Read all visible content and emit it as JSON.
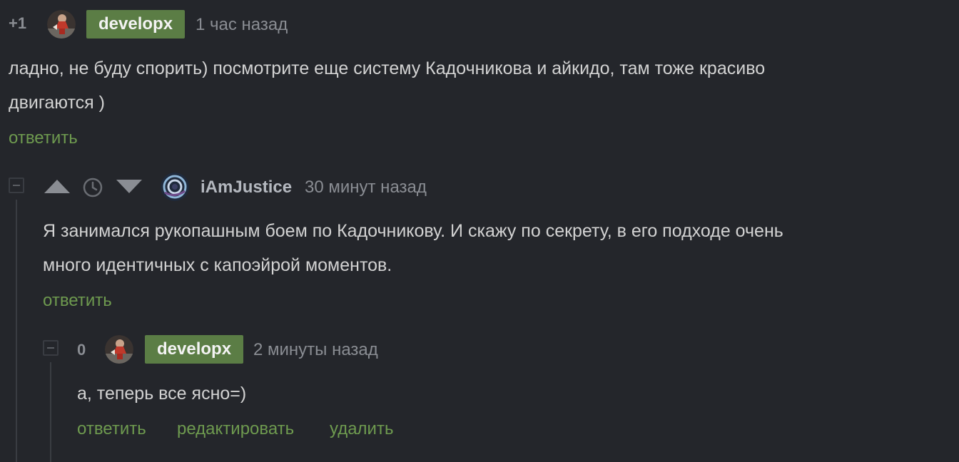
{
  "comments": [
    {
      "score": "+1",
      "author": "developx",
      "time": "1 час назад",
      "text_lines": [
        "ладно, не буду спорить) посмотрите еще систему Кадочникова и айкидо, там тоже красиво",
        "двигаются )"
      ],
      "actions": {
        "reply": "ответить"
      }
    },
    {
      "author": "iAmJustice",
      "time": "30 минут назад",
      "text_lines": [
        "Я занимался рукопашным боем по Кадочникову. И скажу по секрету, в его подходе очень",
        "много идентичных с капоэйрой моментов."
      ],
      "actions": {
        "reply": "ответить"
      }
    },
    {
      "score": "0",
      "author": "developx",
      "time": "2 минуты назад",
      "text_lines": [
        "а, теперь все ясно=)"
      ],
      "actions": {
        "reply": "ответить",
        "edit": "редактировать",
        "delete": "удалить"
      }
    }
  ],
  "colors": {
    "background": "#24262b",
    "accent_green": "#6e9a4f",
    "badge_green": "#5b7d45",
    "text": "#d2d2d2",
    "muted": "#8a8d93"
  },
  "icons": {
    "upvote": "triangle-up-icon",
    "save": "clock-icon",
    "downvote": "triangle-down-icon",
    "collapse": "minus-square-icon"
  }
}
